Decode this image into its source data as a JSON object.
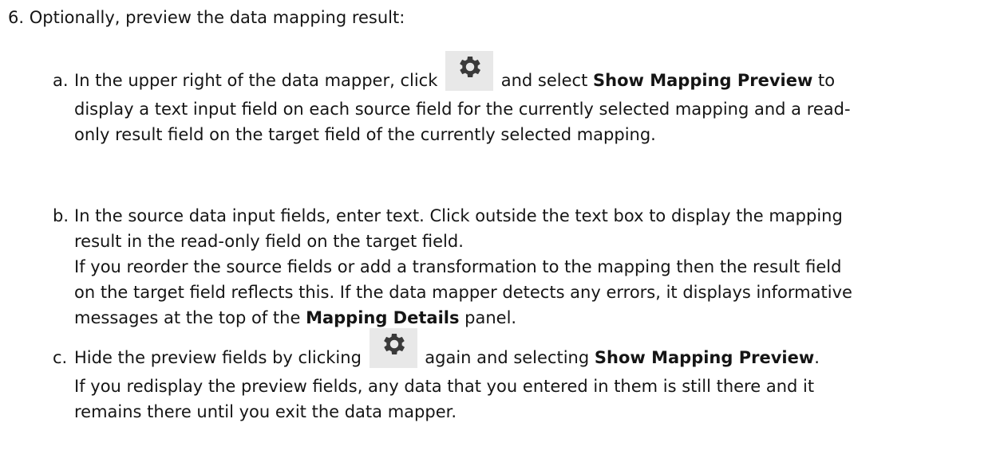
{
  "step": {
    "number": "6.",
    "text": "Optionally, preview the data mapping result:"
  },
  "substeps": [
    {
      "marker": "a.",
      "lines": [
        {
          "before": "In the upper right of the data mapper, click ",
          "icon": "gear-icon",
          "after": " and select ",
          "bold": "Show Mapping Preview",
          "tail": " to"
        },
        "display a text input field on each source field for the currently selected mapping and a read-",
        "only result field on the target field of the currently selected mapping."
      ]
    },
    {
      "marker": "b.",
      "lines": [
        "In the source data input fields, enter text. Click outside the text box to display the mapping",
        "result in the read-only field on the target field.",
        "If you reorder the source fields or add a transformation to the mapping then the result field",
        "on the target field reflects this. If the data mapper detects any errors, it displays informative",
        {
          "before": "messages at the top of the ",
          "bold": "Mapping Details",
          "after": " panel."
        }
      ]
    },
    {
      "marker": "c.",
      "lines": [
        {
          "before": "Hide the preview fields by clicking ",
          "icon": "gear-icon",
          "after": " again and selecting ",
          "bold": "Show Mapping Preview",
          "tail": "."
        },
        "If you redisplay the preview fields, any data that you entered in them is still there and it",
        "remains there until you exit the data mapper."
      ]
    }
  ],
  "colors": {
    "text": "#151515",
    "icon_background": "#e8e8e8",
    "icon": "#3a3a3a"
  }
}
